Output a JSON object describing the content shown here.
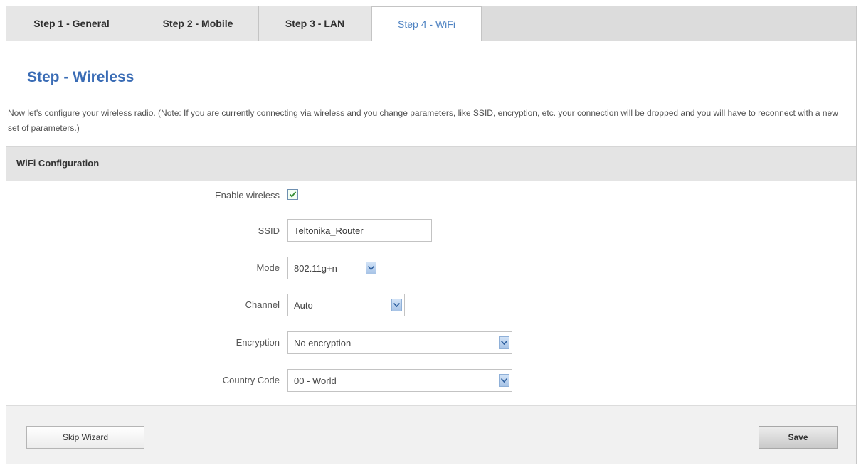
{
  "tabs": [
    {
      "label": "Step 1 - General"
    },
    {
      "label": "Step 2 - Mobile"
    },
    {
      "label": "Step 3 - LAN"
    },
    {
      "label": "Step 4 - WiFi",
      "active": true
    }
  ],
  "page": {
    "title": "Step - Wireless",
    "intro": "Now let's configure your wireless radio. (Note: If you are currently connecting via wireless and you change parameters, like SSID, encryption, etc. your connection will be dropped and you will have to reconnect with a new set of parameters.)"
  },
  "section": {
    "title": "WiFi Configuration"
  },
  "form": {
    "enable_wireless": {
      "label": "Enable wireless",
      "checked": true
    },
    "ssid": {
      "label": "SSID",
      "value": "Teltonika_Router"
    },
    "mode": {
      "label": "Mode",
      "value": "802.11g+n"
    },
    "channel": {
      "label": "Channel",
      "value": "Auto"
    },
    "encryption": {
      "label": "Encryption",
      "value": "No encryption"
    },
    "country_code": {
      "label": "Country Code",
      "value": "00 - World"
    }
  },
  "footer": {
    "skip_label": "Skip Wizard",
    "save_label": "Save"
  },
  "colors": {
    "accent": "#3a6cb5",
    "active_tab_text": "#4f83c2",
    "tabbar_bg": "#dcdcdc",
    "section_bg": "#e4e4e4"
  },
  "icons": {
    "checkbox": "check-icon",
    "dropdown": "chevron-down-icon"
  }
}
